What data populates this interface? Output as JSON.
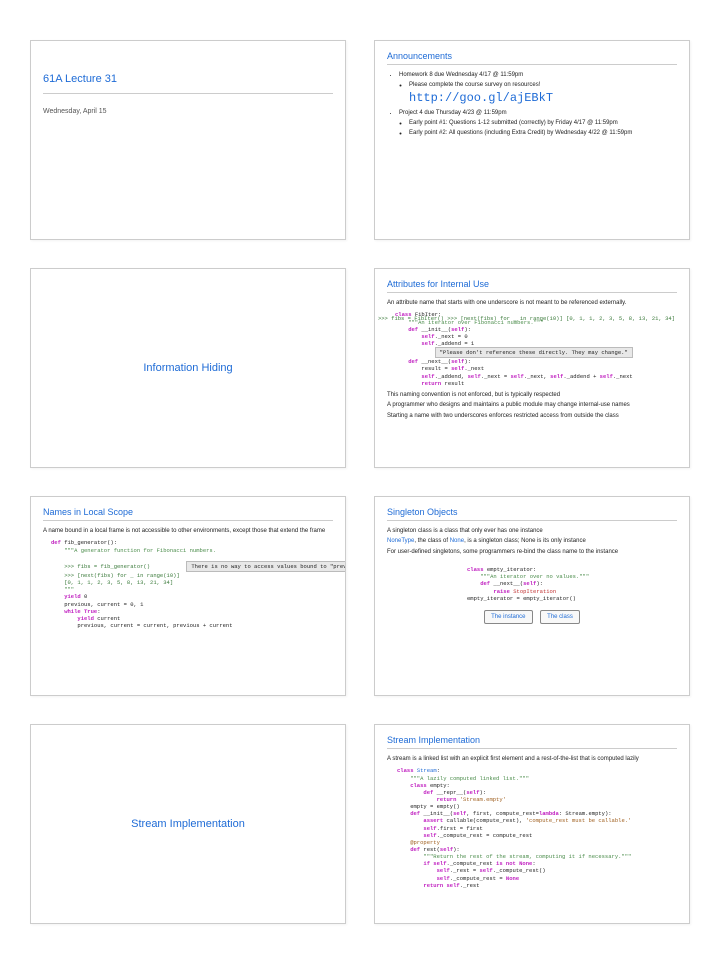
{
  "slide1": {
    "title": "61A Lecture 31",
    "date": "Wednesday, April 15"
  },
  "slide2": {
    "heading": "Announcements",
    "hw": "Homework 8 due Wednesday 4/17 @ 11:59pm",
    "survey_pre": "Please complete the course survey on resources!",
    "survey_url": "http://goo.gl/ajEBkT",
    "proj": "Project 4 due Thursday 4/23 @ 11:59pm",
    "ep1": "Early point #1: Questions 1-12 submitted (correctly) by Friday 4/17 @ 11:59pm",
    "ep2": "Early point #2: All questions (including Extra Credit) by Wednesday 4/22 @ 11:59pm"
  },
  "slide3": {
    "title": "Information Hiding"
  },
  "slide4": {
    "heading": "Attributes for Internal Use",
    "p1": "An attribute name that starts with one underscore is not meant to be referenced externally.",
    "code_left": "class FibIter:\n    \"\"\"An iterator over Fibonacci numbers.\"\"\"\n    def __init__(self):\n        self._next = 0\n        self._addend = 1\n\n    def __next__(self):\n        result = self._next\n        self._addend, self._next = self._next, self._addend + self._next\n        return result",
    "code_right": ">>> fibs = FibIter()\n>>> [next(fibs) for _ in range(10)]\n[0, 1, 1, 2, 3, 5, 8, 13, 21, 34]",
    "callout": "\"Please don't reference these directly. They may change.\"",
    "p2": "This naming convention is not enforced, but is typically respected",
    "p3": "A programmer who designs and maintains a public module may change internal-use names",
    "p4": "Starting a name with two underscores enforces restricted access from outside the class"
  },
  "slide5": {
    "heading": "Names in Local Scope",
    "p1": "A name bound in a local frame is not accessible to other environments, except those that extend the frame",
    "callout": "There is no way to access values bound to \"previous\" and \"current\" externally",
    "code": "def fib_generator():\n    \"\"\"A generator function for Fibonacci numbers.\n\n    >>> fibs = fib_generator()\n    >>> [next(fibs) for _ in range(10)]\n    [0, 1, 1, 2, 3, 5, 8, 13, 21, 34]\n    \"\"\"\n    yield 0\n    previous, current = 0, 1\n    while True:\n        yield current\n        previous, current = current, previous + current"
  },
  "slide6": {
    "heading": "Singleton Objects",
    "p1": "A singleton class is a class that only ever has one instance",
    "p2a": "NoneType",
    "p2b": ", the class of ",
    "p2c": "None",
    "p2d": ", is a singleton class; None is its only instance",
    "p3": "For user-defined singletons, some programmers re-bind the class name to the instance",
    "code": "class empty_iterator:\n    \"\"\"An iterator over no values.\"\"\"\n    def __next__(self):\n        raise StopIteration\nempty_iterator = empty_iterator()",
    "btn1": "The instance",
    "btn2": "The class"
  },
  "slide7": {
    "title": "Stream Implementation"
  },
  "slide8": {
    "heading": "Stream Implementation",
    "p1": "A stream is a linked list with an explicit first element and a rest-of-the-list that is computed lazily",
    "code": "class Stream:\n    \"\"\"A lazily computed linked list.\"\"\"\n    class empty:\n        def __repr__(self):\n            return 'Stream.empty'\n    empty = empty()\n    def __init__(self, first, compute_rest=lambda: Stream.empty):\n        assert callable(compute_rest), 'compute_rest must be callable.'\n        self.first = first\n        self._compute_rest = compute_rest\n    @property\n    def rest(self):\n        \"\"\"Return the rest of the stream, computing it if necessary.\"\"\"\n        if self._compute_rest is not None:\n            self._rest = self._compute_rest()\n            self._compute_rest = None\n        return self._rest"
  }
}
